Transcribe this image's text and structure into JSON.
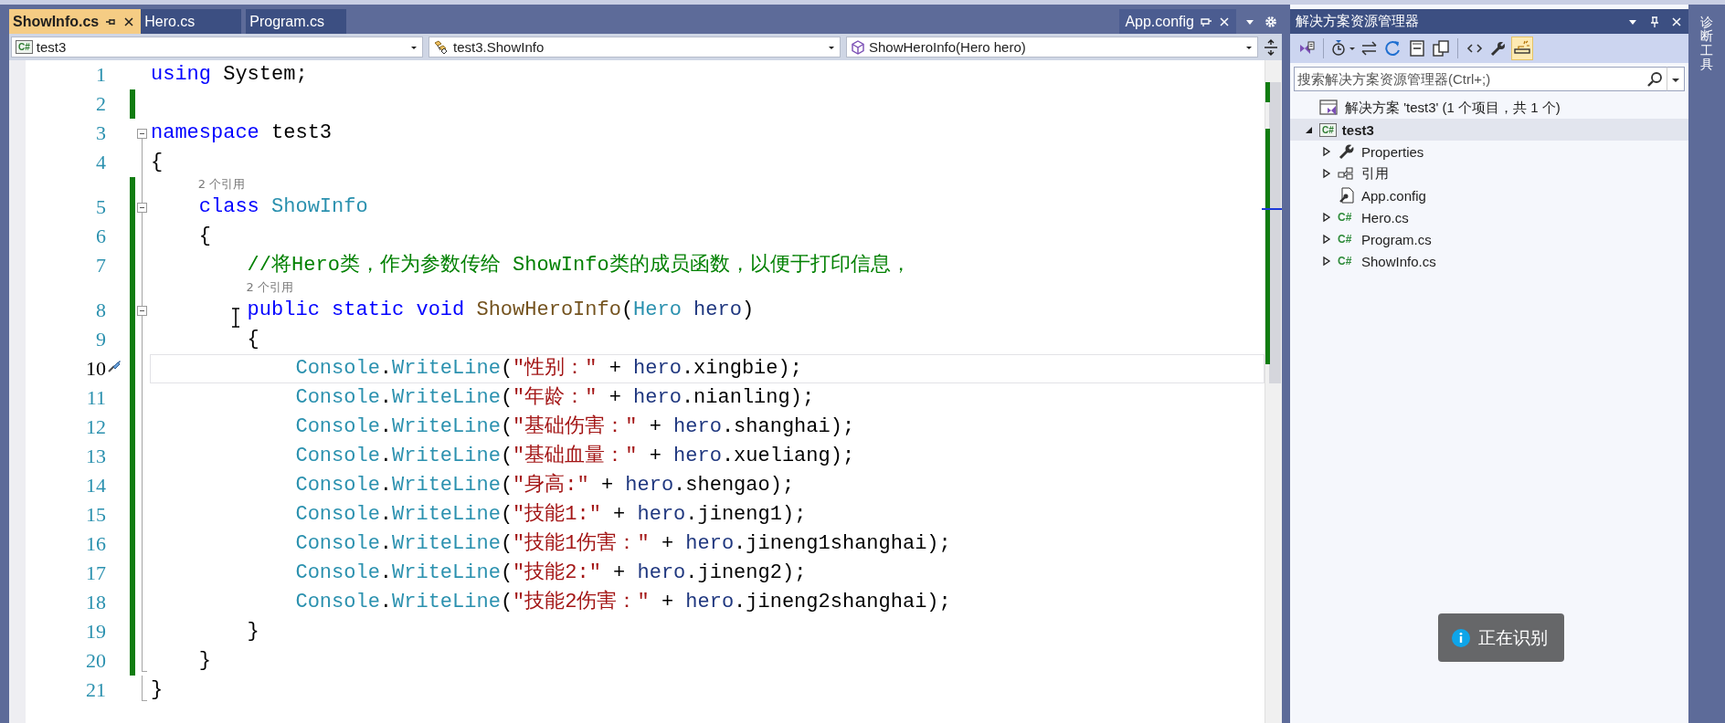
{
  "tabs": [
    {
      "label": "ShowInfo.cs",
      "selected": true
    },
    {
      "label": "Hero.cs",
      "selected": false
    },
    {
      "label": "Program.cs",
      "selected": false
    }
  ],
  "preview_tab": {
    "label": "App.config"
  },
  "navigation_bar": {
    "project": {
      "icon_label": "C#",
      "text": "test3"
    },
    "type": {
      "text": "test3.ShowInfo"
    },
    "member": {
      "text": "ShowHeroInfo(Hero hero)"
    }
  },
  "editor": {
    "lines": [
      {
        "number": "1",
        "kind": "plain",
        "changed": false,
        "current": false,
        "pointer": false,
        "tokens": [
          {
            "kind": "keyword",
            "text": "using"
          },
          {
            "kind": "plain",
            "text": " System;"
          }
        ]
      },
      {
        "number": "2",
        "kind": "plain",
        "changed": true,
        "current": false,
        "pointer": false
      },
      {
        "number": "3",
        "kind": "fold_start",
        "changed": false,
        "current": false,
        "pointer": false,
        "tokens": [
          {
            "kind": "keyword",
            "text": "namespace"
          },
          {
            "kind": "plain",
            "text": " test3"
          }
        ]
      },
      {
        "number": "4",
        "kind": "fold_inner",
        "changed": false,
        "current": false,
        "pointer": false,
        "tokens": [
          {
            "kind": "plain",
            "text": "{"
          }
        ]
      },
      {
        "number": "5",
        "kind": "nested_fold_start",
        "changed": true,
        "current": false,
        "pointer": false,
        "lens": "2 个引用",
        "tokens": [
          {
            "kind": "keyword",
            "text": "    class "
          },
          {
            "kind": "type",
            "text": "ShowInfo"
          }
        ]
      },
      {
        "number": "6",
        "kind": "fold_inner",
        "changed": true,
        "current": false,
        "pointer": false,
        "tokens": [
          {
            "kind": "plain",
            "text": "    {"
          }
        ]
      },
      {
        "number": "7",
        "kind": "fold_inner",
        "changed": true,
        "current": false,
        "pointer": false,
        "tokens": [
          {
            "kind": "comment",
            "text": "        //将Hero类，作为参数传给 ShowInfo类的成员函数，以便于打印信息，"
          }
        ]
      },
      {
        "number": "8",
        "kind": "nested_fold_start",
        "changed": true,
        "current": false,
        "pointer": true,
        "lens": "2 个引用",
        "tokens": [
          {
            "kind": "keyword",
            "text": "        public static void "
          },
          {
            "kind": "method",
            "text": "ShowHeroInfo"
          },
          {
            "kind": "plain",
            "text": "("
          },
          {
            "kind": "type",
            "text": "Hero"
          },
          {
            "kind": "parameter",
            "text": " hero"
          },
          {
            "kind": "plain",
            "text": ")"
          }
        ]
      },
      {
        "number": "9",
        "kind": "fold_inner",
        "changed": true,
        "current": false,
        "pointer": false,
        "tokens": [
          {
            "kind": "plain",
            "text": "        {"
          }
        ]
      },
      {
        "number": "10",
        "kind": "fold_inner",
        "changed": true,
        "current": true,
        "pointer": false,
        "tokens": [
          {
            "kind": "type",
            "text": "            Console"
          },
          {
            "kind": "plain",
            "text": "."
          },
          {
            "kind": "type",
            "text": "WriteLine"
          },
          {
            "kind": "plain",
            "text": "("
          },
          {
            "kind": "string",
            "text": "\"性别：\""
          },
          {
            "kind": "plain",
            "text": " + "
          },
          {
            "kind": "parameter",
            "text": "hero"
          },
          {
            "kind": "plain",
            "text": ".xingbie);"
          }
        ]
      },
      {
        "number": "11",
        "kind": "fold_inner",
        "changed": true,
        "current": false,
        "pointer": false,
        "tokens": [
          {
            "kind": "type",
            "text": "            Console"
          },
          {
            "kind": "plain",
            "text": "."
          },
          {
            "kind": "type",
            "text": "WriteLine"
          },
          {
            "kind": "plain",
            "text": "("
          },
          {
            "kind": "string",
            "text": "\"年龄：\""
          },
          {
            "kind": "plain",
            "text": " + "
          },
          {
            "kind": "parameter",
            "text": "hero"
          },
          {
            "kind": "plain",
            "text": ".nianling);"
          }
        ]
      },
      {
        "number": "12",
        "kind": "fold_inner",
        "changed": true,
        "current": false,
        "pointer": false,
        "tokens": [
          {
            "kind": "type",
            "text": "            Console"
          },
          {
            "kind": "plain",
            "text": "."
          },
          {
            "kind": "type",
            "text": "WriteLine"
          },
          {
            "kind": "plain",
            "text": "("
          },
          {
            "kind": "string",
            "text": "\"基础伤害：\""
          },
          {
            "kind": "plain",
            "text": " + "
          },
          {
            "kind": "parameter",
            "text": "hero"
          },
          {
            "kind": "plain",
            "text": ".shanghai);"
          }
        ]
      },
      {
        "number": "13",
        "kind": "fold_inner",
        "changed": true,
        "current": false,
        "pointer": false,
        "tokens": [
          {
            "kind": "type",
            "text": "            Console"
          },
          {
            "kind": "plain",
            "text": "."
          },
          {
            "kind": "type",
            "text": "WriteLine"
          },
          {
            "kind": "plain",
            "text": "("
          },
          {
            "kind": "string",
            "text": "\"基础血量：\""
          },
          {
            "kind": "plain",
            "text": " + "
          },
          {
            "kind": "parameter",
            "text": "hero"
          },
          {
            "kind": "plain",
            "text": ".xueliang);"
          }
        ]
      },
      {
        "number": "14",
        "kind": "fold_inner",
        "changed": true,
        "current": false,
        "pointer": false,
        "tokens": [
          {
            "kind": "type",
            "text": "            Console"
          },
          {
            "kind": "plain",
            "text": "."
          },
          {
            "kind": "type",
            "text": "WriteLine"
          },
          {
            "kind": "plain",
            "text": "("
          },
          {
            "kind": "string",
            "text": "\"身高:\""
          },
          {
            "kind": "plain",
            "text": " + "
          },
          {
            "kind": "parameter",
            "text": "hero"
          },
          {
            "kind": "plain",
            "text": ".shengao);"
          }
        ]
      },
      {
        "number": "15",
        "kind": "fold_inner",
        "changed": true,
        "current": false,
        "pointer": false,
        "tokens": [
          {
            "kind": "type",
            "text": "            Console"
          },
          {
            "kind": "plain",
            "text": "."
          },
          {
            "kind": "type",
            "text": "WriteLine"
          },
          {
            "kind": "plain",
            "text": "("
          },
          {
            "kind": "string",
            "text": "\"技能1:\""
          },
          {
            "kind": "plain",
            "text": " + "
          },
          {
            "kind": "parameter",
            "text": "hero"
          },
          {
            "kind": "plain",
            "text": ".jineng1);"
          }
        ]
      },
      {
        "number": "16",
        "kind": "fold_inner",
        "changed": true,
        "current": false,
        "pointer": false,
        "tokens": [
          {
            "kind": "type",
            "text": "            Console"
          },
          {
            "kind": "plain",
            "text": "."
          },
          {
            "kind": "type",
            "text": "WriteLine"
          },
          {
            "kind": "plain",
            "text": "("
          },
          {
            "kind": "string",
            "text": "\"技能1伤害：\""
          },
          {
            "kind": "plain",
            "text": " + "
          },
          {
            "kind": "parameter",
            "text": "hero"
          },
          {
            "kind": "plain",
            "text": ".jineng1shanghai);"
          }
        ]
      },
      {
        "number": "17",
        "kind": "fold_inner",
        "changed": true,
        "current": false,
        "pointer": false,
        "tokens": [
          {
            "kind": "type",
            "text": "            Console"
          },
          {
            "kind": "plain",
            "text": "."
          },
          {
            "kind": "type",
            "text": "WriteLine"
          },
          {
            "kind": "plain",
            "text": "("
          },
          {
            "kind": "string",
            "text": "\"技能2:\""
          },
          {
            "kind": "plain",
            "text": " + "
          },
          {
            "kind": "parameter",
            "text": "hero"
          },
          {
            "kind": "plain",
            "text": ".jineng2);"
          }
        ]
      },
      {
        "number": "18",
        "kind": "fold_inner",
        "changed": true,
        "current": false,
        "pointer": false,
        "tokens": [
          {
            "kind": "type",
            "text": "            Console"
          },
          {
            "kind": "plain",
            "text": "."
          },
          {
            "kind": "type",
            "text": "WriteLine"
          },
          {
            "kind": "plain",
            "text": "("
          },
          {
            "kind": "string",
            "text": "\"技能2伤害：\""
          },
          {
            "kind": "plain",
            "text": " + "
          },
          {
            "kind": "parameter",
            "text": "hero"
          },
          {
            "kind": "plain",
            "text": ".jineng2shanghai);"
          }
        ]
      },
      {
        "number": "19",
        "kind": "fold_inner",
        "changed": true,
        "current": false,
        "pointer": false,
        "tokens": [
          {
            "kind": "plain",
            "text": "        }"
          }
        ]
      },
      {
        "number": "20",
        "kind": "fold_end",
        "changed": true,
        "current": false,
        "pointer": false,
        "tokens": [
          {
            "kind": "plain",
            "text": "    }"
          }
        ]
      },
      {
        "number": "21",
        "kind": "fold_end",
        "changed": false,
        "current": false,
        "pointer": false,
        "tokens": [
          {
            "kind": "plain",
            "text": "}"
          }
        ]
      }
    ]
  },
  "solution_explorer": {
    "title": "解决方案资源管理器",
    "toolbar": [
      {
        "kind": "switch_views",
        "selected": false
      },
      {
        "kind": "separator"
      },
      {
        "kind": "history",
        "selected": false
      },
      {
        "kind": "sync",
        "selected": false
      },
      {
        "kind": "refresh",
        "selected": false
      },
      {
        "kind": "collapse_all",
        "selected": false
      },
      {
        "kind": "show_all_files",
        "selected": false
      },
      {
        "kind": "separator"
      },
      {
        "kind": "code",
        "selected": false
      },
      {
        "kind": "properties",
        "selected": false
      },
      {
        "kind": "preview",
        "selected": true
      }
    ],
    "search": {
      "placeholder": "搜索解决方案资源管理器(Ctrl+;)"
    },
    "tree": {
      "label": "解决方案 'test3' (1 个项目，共 1 个)",
      "children": [
        {
          "label": "test3",
          "icon_label": "C#",
          "expanded": true,
          "selected": true,
          "children": [
            {
              "label": "Properties",
              "kind": "properties",
              "expanded": false
            },
            {
              "label": "引用",
              "kind": "references",
              "expanded": false
            },
            {
              "label": "App.config",
              "kind": "config"
            },
            {
              "label": "Hero.cs",
              "kind": "csharp",
              "icon_label": "C#",
              "expanded": false
            },
            {
              "label": "Program.cs",
              "kind": "csharp",
              "icon_label": "C#",
              "expanded": false
            },
            {
              "label": "ShowInfo.cs",
              "kind": "csharp",
              "icon_label": "C#",
              "expanded": false
            }
          ]
        }
      ]
    }
  },
  "side_tab": {
    "label": "诊断工具"
  },
  "toast": {
    "text": "正在识别"
  }
}
